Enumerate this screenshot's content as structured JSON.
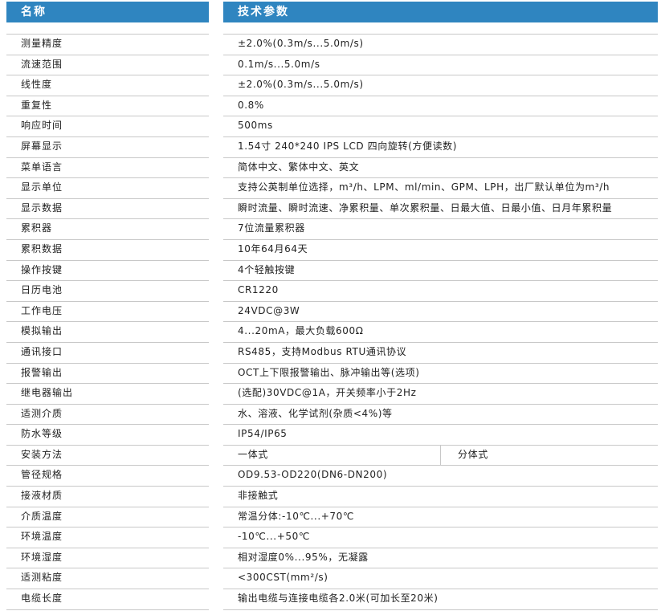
{
  "header": {
    "name_label": "名称",
    "param_label": "技术参数"
  },
  "rows": [
    {
      "name": "测量精度",
      "value": "±2.0%(0.3m/s...5.0m/s)"
    },
    {
      "name": "流速范围",
      "value": "0.1m/s...5.0m/s"
    },
    {
      "name": "线性度",
      "value": "±2.0%(0.3m/s...5.0m/s)"
    },
    {
      "name": "重复性",
      "value": "0.8%"
    },
    {
      "name": "响应时间",
      "value": "500ms"
    },
    {
      "name": "屏幕显示",
      "value": "1.54寸 240*240 IPS LCD 四向旋转(方便读数)"
    },
    {
      "name": "菜单语言",
      "value": "简体中文、繁体中文、英文"
    },
    {
      "name": "显示单位",
      "value": "支持公英制单位选择，m³/h、LPM、ml/min、GPM、LPH，出厂默认单位为m³/h"
    },
    {
      "name": "显示数据",
      "value": "瞬时流量、瞬时流速、净累积量、单次累积量、日最大值、日最小值、日月年累积量"
    },
    {
      "name": "累积器",
      "value": "7位流量累积器"
    },
    {
      "name": "累积数据",
      "value": "10年64月64天"
    },
    {
      "name": "操作按键",
      "value": "4个轻触按键"
    },
    {
      "name": "日历电池",
      "value": "CR1220"
    },
    {
      "name": "工作电压",
      "value": "24VDC@3W"
    },
    {
      "name": "模拟输出",
      "value": "4...20mA，最大负载600Ω"
    },
    {
      "name": "通讯接口",
      "value": "RS485，支持Modbus RTU通讯协议"
    },
    {
      "name": "报警输出",
      "value": "OCT上下限报警输出、脉冲输出等(选项)"
    },
    {
      "name": "继电器输出",
      "value": "(选配)30VDC@1A，开关频率小于2Hz"
    },
    {
      "name": "适测介质",
      "value": "水、溶液、化学试剂(杂质<4%)等"
    },
    {
      "name": "防水等级",
      "value": "IP54/IP65"
    },
    {
      "name": "安装方法",
      "value": "一体式",
      "value2": "分体式"
    },
    {
      "name": "管径规格",
      "value": "OD9.53-OD220(DN6-DN200)"
    },
    {
      "name": "接液材质",
      "value": "非接触式"
    },
    {
      "name": "介质温度",
      "value": "常温分体:-10℃...+70℃"
    },
    {
      "name": "环境温度",
      "value": "-10℃...+50℃"
    },
    {
      "name": "环境湿度",
      "value": "相对湿度0%...95%，无凝露"
    },
    {
      "name": "适测粘度",
      "value": "<300CST(mm²/s)"
    },
    {
      "name": "电缆长度",
      "value": "输出电缆与连接电缆各2.0米(可加长至20米)"
    }
  ]
}
